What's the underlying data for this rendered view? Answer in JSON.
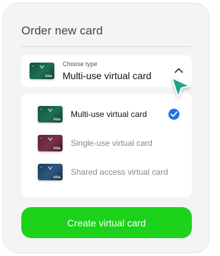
{
  "title": "Order new card",
  "select": {
    "small_label": "Choose type",
    "value": "Multi-use virtual card",
    "chevron_icon": "chevron-up-icon"
  },
  "options": [
    {
      "label": "Multi-use virtual card",
      "selected": true,
      "card_color": "#1a5e48"
    },
    {
      "label": "Single-use virtual card",
      "selected": false,
      "card_color": "#6b2a3f"
    },
    {
      "label": "Shared access virtual card",
      "selected": false,
      "card_color": "#274a70"
    }
  ],
  "card_brand": "VISA",
  "create_button": {
    "label": "Create virtual card"
  },
  "colors": {
    "accent_green": "#1cd21a",
    "check_blue": "#1a73e8",
    "cursor_teal": "#1fa68c"
  }
}
